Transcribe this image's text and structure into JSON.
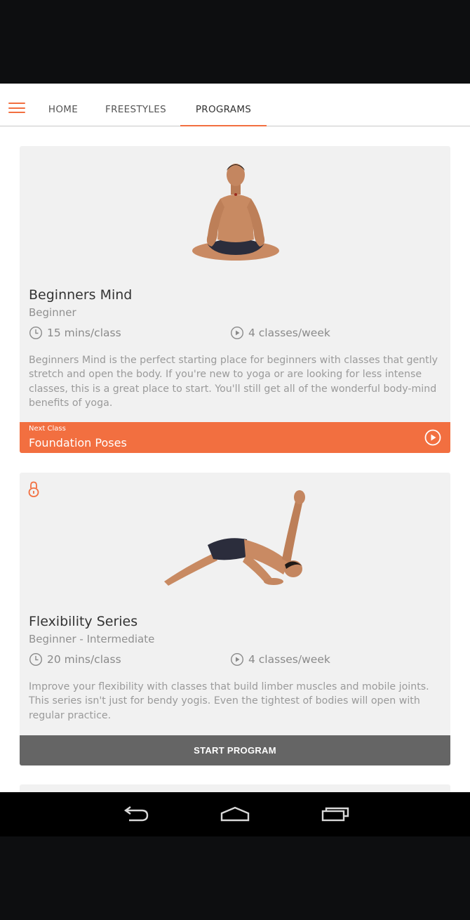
{
  "nav": {
    "tabs": [
      {
        "label": "HOME",
        "active": false
      },
      {
        "label": "FREESTYLES",
        "active": false
      },
      {
        "label": "PROGRAMS",
        "active": true
      }
    ]
  },
  "programs": [
    {
      "title": "Beginners Mind",
      "level": "Beginner",
      "duration": "15 mins/class",
      "frequency": "4 classes/week",
      "description": "Beginners Mind is the perfect starting place for beginners with classes that gently stretch and open the body. If you're new to yoga or are looking for less intense classes, this is a great place to start. You'll still get all of the wonderful body-mind benefits of yoga.",
      "next_label": "Next Class",
      "next_title": "Foundation Poses",
      "locked": false
    },
    {
      "title": "Flexibility Series",
      "level": "Beginner - Intermediate",
      "duration": "20 mins/class",
      "frequency": "4 classes/week",
      "description": "Improve your flexibility with classes that build limber muscles and mobile joints. This series isn't just for bendy yogis. Even the tightest of bodies will open with regular practice.",
      "action_label": "START PROGRAM",
      "locked": true
    }
  ],
  "colors": {
    "accent": "#f26f40",
    "card_bg": "#f1f1f1",
    "start_button": "#656565"
  },
  "icons": {
    "menu": "hamburger-icon",
    "duration": "clock-icon",
    "frequency": "play-circle-icon",
    "lock": "lock-icon",
    "back": "back-icon",
    "home": "home-icon",
    "recents": "recents-icon"
  }
}
